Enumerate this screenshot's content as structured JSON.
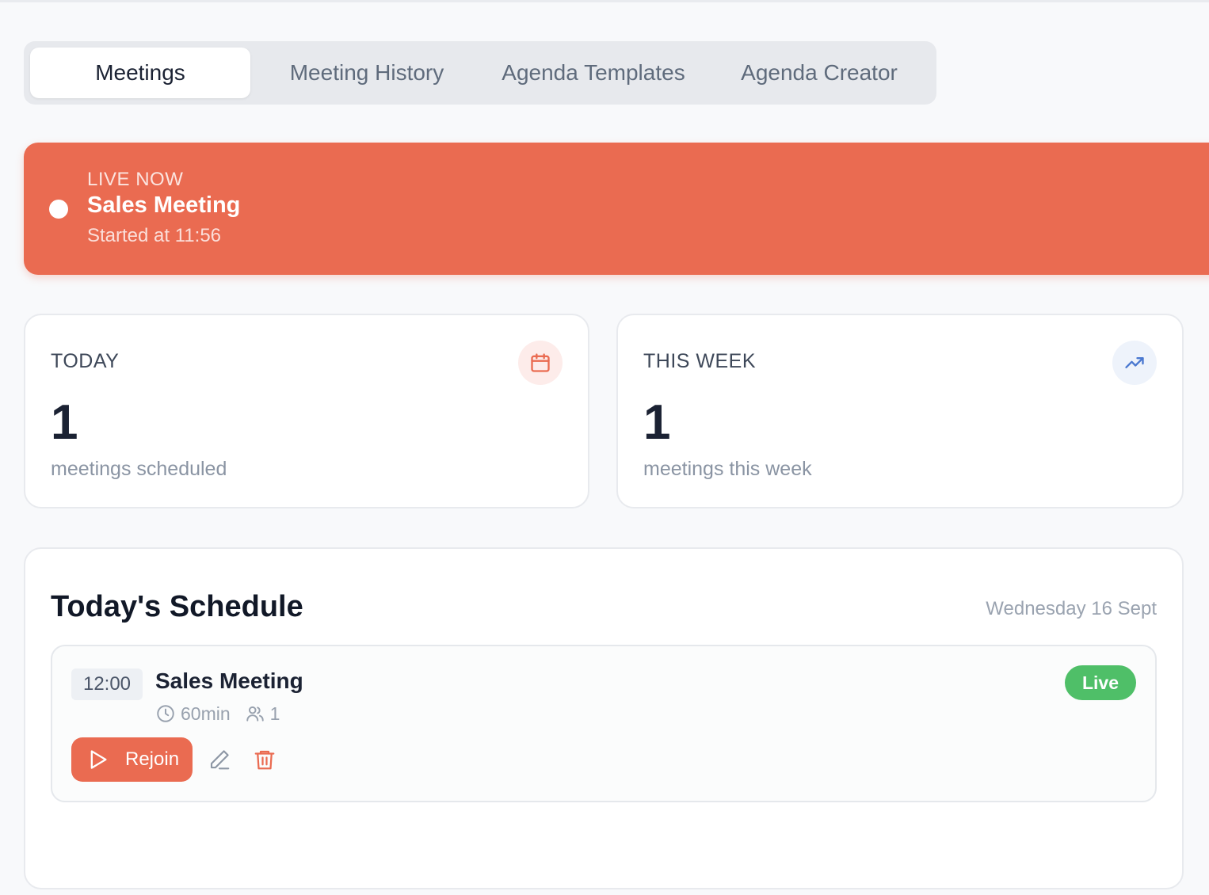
{
  "tabs": [
    {
      "label": "Meetings",
      "active": true
    },
    {
      "label": "Meeting History",
      "active": false
    },
    {
      "label": "Agenda Templates",
      "active": false
    },
    {
      "label": "Agenda Creator",
      "active": false
    }
  ],
  "live_banner": {
    "label": "LIVE NOW",
    "title": "Sales Meeting",
    "started": "Started at 11:56",
    "color": "#ea6b51"
  },
  "stats": {
    "today": {
      "label": "TODAY",
      "value": "1",
      "subtitle": "meetings scheduled",
      "icon": "calendar-icon"
    },
    "week": {
      "label": "THIS WEEK",
      "value": "1",
      "subtitle": "meetings this week",
      "icon": "trending-up-icon"
    }
  },
  "schedule": {
    "title": "Today's Schedule",
    "date": "Wednesday 16 Sept",
    "meetings": [
      {
        "time": "12:00",
        "title": "Sales Meeting",
        "duration": "60min",
        "attendees": "1",
        "status": "Live",
        "status_color": "#4fbf68",
        "rejoin_label": "Rejoin"
      }
    ]
  }
}
